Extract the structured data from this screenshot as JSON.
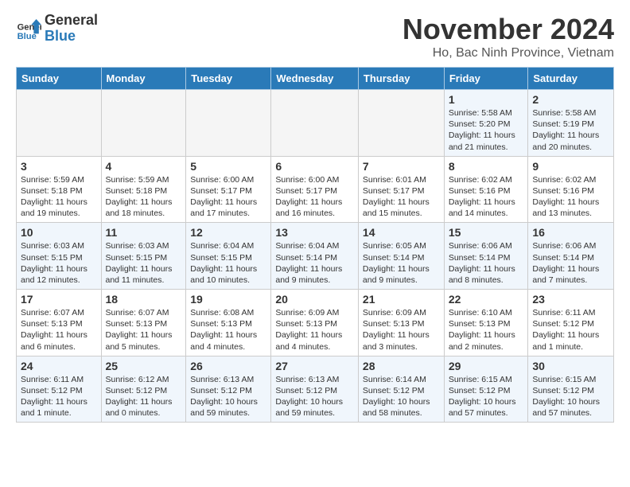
{
  "header": {
    "logo_general": "General",
    "logo_blue": "Blue",
    "month_title": "November 2024",
    "location": "Ho, Bac Ninh Province, Vietnam"
  },
  "weekdays": [
    "Sunday",
    "Monday",
    "Tuesday",
    "Wednesday",
    "Thursday",
    "Friday",
    "Saturday"
  ],
  "weeks": [
    [
      {
        "day": "",
        "info": ""
      },
      {
        "day": "",
        "info": ""
      },
      {
        "day": "",
        "info": ""
      },
      {
        "day": "",
        "info": ""
      },
      {
        "day": "",
        "info": ""
      },
      {
        "day": "1",
        "info": "Sunrise: 5:58 AM\nSunset: 5:20 PM\nDaylight: 11 hours\nand 21 minutes."
      },
      {
        "day": "2",
        "info": "Sunrise: 5:58 AM\nSunset: 5:19 PM\nDaylight: 11 hours\nand 20 minutes."
      }
    ],
    [
      {
        "day": "3",
        "info": "Sunrise: 5:59 AM\nSunset: 5:18 PM\nDaylight: 11 hours\nand 19 minutes."
      },
      {
        "day": "4",
        "info": "Sunrise: 5:59 AM\nSunset: 5:18 PM\nDaylight: 11 hours\nand 18 minutes."
      },
      {
        "day": "5",
        "info": "Sunrise: 6:00 AM\nSunset: 5:17 PM\nDaylight: 11 hours\nand 17 minutes."
      },
      {
        "day": "6",
        "info": "Sunrise: 6:00 AM\nSunset: 5:17 PM\nDaylight: 11 hours\nand 16 minutes."
      },
      {
        "day": "7",
        "info": "Sunrise: 6:01 AM\nSunset: 5:17 PM\nDaylight: 11 hours\nand 15 minutes."
      },
      {
        "day": "8",
        "info": "Sunrise: 6:02 AM\nSunset: 5:16 PM\nDaylight: 11 hours\nand 14 minutes."
      },
      {
        "day": "9",
        "info": "Sunrise: 6:02 AM\nSunset: 5:16 PM\nDaylight: 11 hours\nand 13 minutes."
      }
    ],
    [
      {
        "day": "10",
        "info": "Sunrise: 6:03 AM\nSunset: 5:15 PM\nDaylight: 11 hours\nand 12 minutes."
      },
      {
        "day": "11",
        "info": "Sunrise: 6:03 AM\nSunset: 5:15 PM\nDaylight: 11 hours\nand 11 minutes."
      },
      {
        "day": "12",
        "info": "Sunrise: 6:04 AM\nSunset: 5:15 PM\nDaylight: 11 hours\nand 10 minutes."
      },
      {
        "day": "13",
        "info": "Sunrise: 6:04 AM\nSunset: 5:14 PM\nDaylight: 11 hours\nand 9 minutes."
      },
      {
        "day": "14",
        "info": "Sunrise: 6:05 AM\nSunset: 5:14 PM\nDaylight: 11 hours\nand 9 minutes."
      },
      {
        "day": "15",
        "info": "Sunrise: 6:06 AM\nSunset: 5:14 PM\nDaylight: 11 hours\nand 8 minutes."
      },
      {
        "day": "16",
        "info": "Sunrise: 6:06 AM\nSunset: 5:14 PM\nDaylight: 11 hours\nand 7 minutes."
      }
    ],
    [
      {
        "day": "17",
        "info": "Sunrise: 6:07 AM\nSunset: 5:13 PM\nDaylight: 11 hours\nand 6 minutes."
      },
      {
        "day": "18",
        "info": "Sunrise: 6:07 AM\nSunset: 5:13 PM\nDaylight: 11 hours\nand 5 minutes."
      },
      {
        "day": "19",
        "info": "Sunrise: 6:08 AM\nSunset: 5:13 PM\nDaylight: 11 hours\nand 4 minutes."
      },
      {
        "day": "20",
        "info": "Sunrise: 6:09 AM\nSunset: 5:13 PM\nDaylight: 11 hours\nand 4 minutes."
      },
      {
        "day": "21",
        "info": "Sunrise: 6:09 AM\nSunset: 5:13 PM\nDaylight: 11 hours\nand 3 minutes."
      },
      {
        "day": "22",
        "info": "Sunrise: 6:10 AM\nSunset: 5:13 PM\nDaylight: 11 hours\nand 2 minutes."
      },
      {
        "day": "23",
        "info": "Sunrise: 6:11 AM\nSunset: 5:12 PM\nDaylight: 11 hours\nand 1 minute."
      }
    ],
    [
      {
        "day": "24",
        "info": "Sunrise: 6:11 AM\nSunset: 5:12 PM\nDaylight: 11 hours\nand 1 minute."
      },
      {
        "day": "25",
        "info": "Sunrise: 6:12 AM\nSunset: 5:12 PM\nDaylight: 11 hours\nand 0 minutes."
      },
      {
        "day": "26",
        "info": "Sunrise: 6:13 AM\nSunset: 5:12 PM\nDaylight: 10 hours\nand 59 minutes."
      },
      {
        "day": "27",
        "info": "Sunrise: 6:13 AM\nSunset: 5:12 PM\nDaylight: 10 hours\nand 59 minutes."
      },
      {
        "day": "28",
        "info": "Sunrise: 6:14 AM\nSunset: 5:12 PM\nDaylight: 10 hours\nand 58 minutes."
      },
      {
        "day": "29",
        "info": "Sunrise: 6:15 AM\nSunset: 5:12 PM\nDaylight: 10 hours\nand 57 minutes."
      },
      {
        "day": "30",
        "info": "Sunrise: 6:15 AM\nSunset: 5:12 PM\nDaylight: 10 hours\nand 57 minutes."
      }
    ]
  ]
}
